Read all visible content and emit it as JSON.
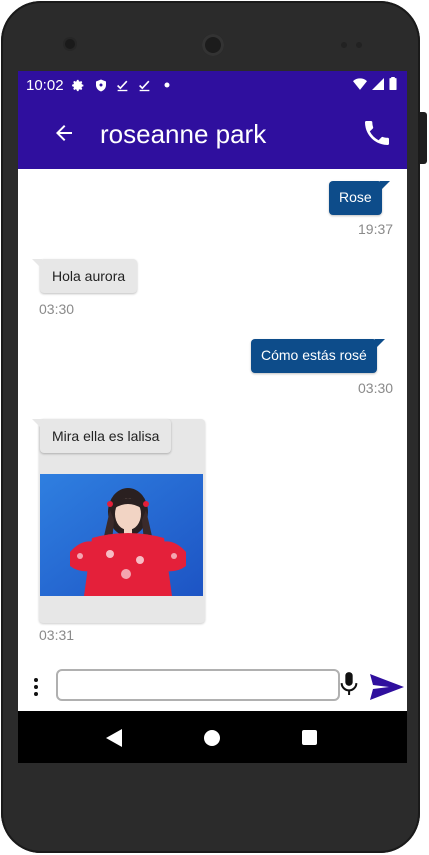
{
  "status_bar": {
    "time": "10:02",
    "icons": [
      "gear-icon",
      "shield-icon",
      "check-icon",
      "check-icon",
      "dot-icon",
      "wifi-icon",
      "signal-icon",
      "battery-icon"
    ]
  },
  "app_bar": {
    "title": "roseanne park",
    "back_icon": "arrow-back-icon",
    "call_icon": "phone-icon"
  },
  "messages": [
    {
      "direction": "out",
      "text": "Rose",
      "time": "19:37"
    },
    {
      "direction": "in",
      "text": "Hola aurora",
      "time": "03:30"
    },
    {
      "direction": "out",
      "text": "Cómo estás rosé",
      "time": "03:30"
    },
    {
      "direction": "in",
      "text": "Mira ella es lalisa",
      "time": "03:31",
      "has_image": true
    }
  ],
  "composer": {
    "value": "",
    "menu_icon": "more-vert-icon",
    "mic_icon": "mic-icon",
    "send_icon": "send-icon"
  },
  "colors": {
    "app_bar": "#2f0f9e",
    "outgoing_bubble": "#0d4c8a",
    "incoming_bubble": "#e7e7e7"
  }
}
